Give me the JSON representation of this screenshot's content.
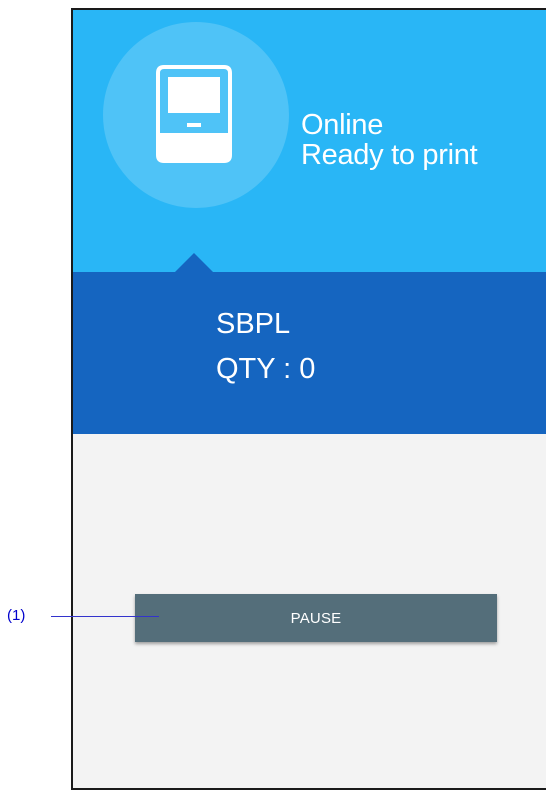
{
  "status": {
    "line1": "Online",
    "line2": "Ready to print",
    "icon": "printer-icon"
  },
  "info": {
    "language": "SBPL",
    "quantity": "QTY : 0"
  },
  "actions": {
    "pause_label": "PAUSE"
  },
  "annotation": {
    "label": "(1)"
  },
  "colors": {
    "status_bg": "#29b6f6",
    "circle_bg": "#4fc3f7",
    "info_bg": "#1565c0",
    "body_bg": "#f3f3f3",
    "button_bg": "#546e7a",
    "callout": "#0000cc"
  }
}
